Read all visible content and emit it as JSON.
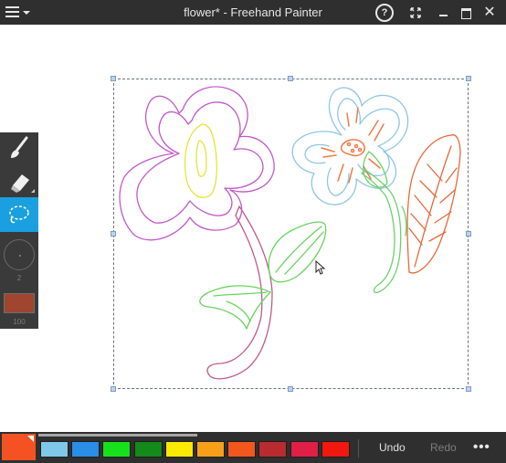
{
  "window": {
    "title": "flower* - Freehand Painter",
    "help_label": "?",
    "close_label": "✕"
  },
  "tools": [
    {
      "name": "brush",
      "icon": "brush-icon"
    },
    {
      "name": "eraser",
      "icon": "eraser-icon"
    },
    {
      "name": "lasso-select",
      "icon": "lasso-select-icon",
      "active": true
    }
  ],
  "brush": {
    "size": "2",
    "opacity": "100",
    "color": "#a0452f"
  },
  "palette": {
    "current_color": "#f45223",
    "colors": [
      "#7fc8ea",
      "#2a8ee8",
      "#17e11a",
      "#138a1a",
      "#fde800",
      "#f6a01a",
      "#f2571e",
      "#b82b2e",
      "#e01f47",
      "#f2170f"
    ]
  },
  "actions": {
    "undo_label": "Undo",
    "redo_label": "Redo",
    "more_label": "•••"
  }
}
